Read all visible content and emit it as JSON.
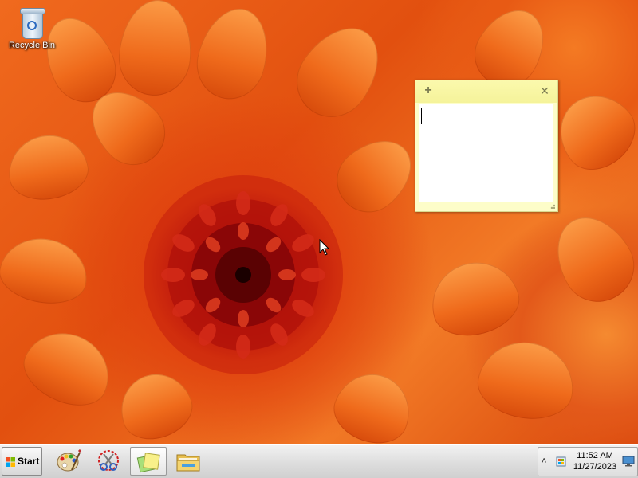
{
  "desktop": {
    "wallpaper": "orange-chrysanthemum",
    "accent": "#e8561a",
    "icons": [
      {
        "label": "Recycle Bin",
        "icon": "recycle-bin-icon"
      }
    ]
  },
  "sticky_note": {
    "add_icon": "+",
    "close_icon": "✕",
    "text": "",
    "background": "#fdfdc9",
    "header_color": "#f5f39a"
  },
  "taskbar": {
    "start_label": "Start",
    "pinned": [
      {
        "name": "paint",
        "icon": "paint-palette-icon"
      },
      {
        "name": "snipping-tool",
        "icon": "snipping-tool-icon"
      },
      {
        "name": "sticky-notes",
        "icon": "sticky-notes-icon",
        "active": true
      },
      {
        "name": "windows-explorer",
        "icon": "folder-icon"
      }
    ],
    "tray": {
      "chevron": "˄",
      "time": "11:52 AM",
      "date": "11/27/2023"
    }
  }
}
